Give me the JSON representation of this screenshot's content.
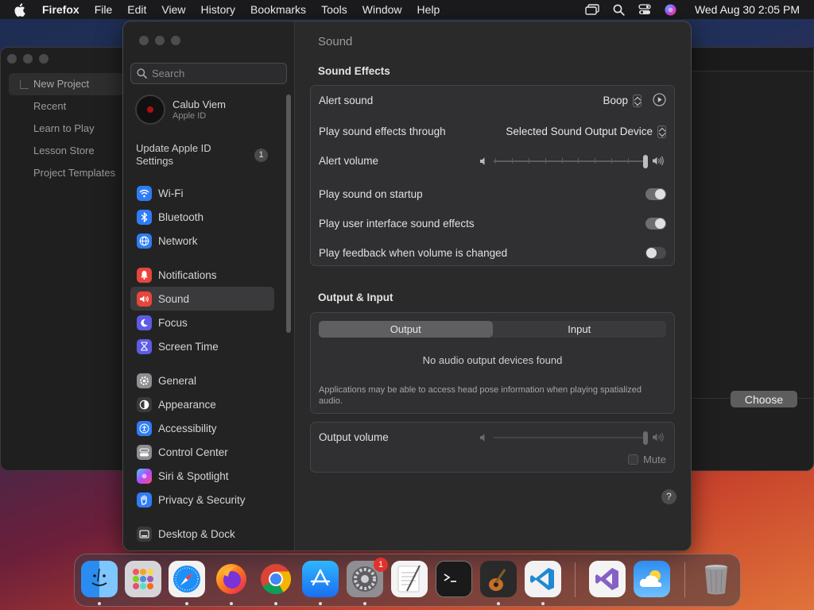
{
  "menubar": {
    "app_name": "Firefox",
    "items": [
      "File",
      "Edit",
      "View",
      "History",
      "Bookmarks",
      "Tools",
      "Window",
      "Help"
    ],
    "clock": "Wed Aug 30  2:05 PM",
    "icons": [
      "apple-icon",
      "screen-mirroring-icon",
      "spotlight-search-icon",
      "control-center-icon",
      "siri-icon"
    ]
  },
  "background_app": {
    "sidebar": [
      "New Project",
      "Recent",
      "Learn to Play",
      "Lesson Store",
      "Project Templates"
    ],
    "choose_label": "Choose"
  },
  "settings": {
    "search_placeholder": "Search",
    "account": {
      "name": "Calub Viem",
      "subtitle": "Apple ID"
    },
    "update": {
      "label": "Update Apple ID Settings",
      "badge": "1"
    },
    "nav_groups": [
      [
        {
          "label": "Wi-Fi",
          "icon": "wifi-icon",
          "color": "#2f7cf6"
        },
        {
          "label": "Bluetooth",
          "icon": "bluetooth-icon",
          "color": "#2f7cf6"
        },
        {
          "label": "Network",
          "icon": "globe-icon",
          "color": "#2f7cf6"
        }
      ],
      [
        {
          "label": "Notifications",
          "icon": "bell-icon",
          "color": "#e8453c"
        },
        {
          "label": "Sound",
          "icon": "speaker-icon",
          "color": "#e8453c",
          "selected": true
        },
        {
          "label": "Focus",
          "icon": "moon-icon",
          "color": "#5e5ce6"
        },
        {
          "label": "Screen Time",
          "icon": "hourglass-icon",
          "color": "#5e5ce6"
        }
      ],
      [
        {
          "label": "General",
          "icon": "gear-icon",
          "color": "#8e8e93"
        },
        {
          "label": "Appearance",
          "icon": "appearance-icon",
          "color": "#3a3a3c"
        },
        {
          "label": "Accessibility",
          "icon": "accessibility-icon",
          "color": "#2f7cf6"
        },
        {
          "label": "Control Center",
          "icon": "control-center-icon",
          "color": "#8e8e93"
        },
        {
          "label": "Siri & Spotlight",
          "icon": "siri-icon",
          "color": "#b04ad0"
        },
        {
          "label": "Privacy & Security",
          "icon": "hand-icon",
          "color": "#2f7cf6"
        }
      ],
      [
        {
          "label": "Desktop & Dock",
          "icon": "dock-icon",
          "color": "#3a3a3c"
        }
      ]
    ],
    "content": {
      "title": "Sound",
      "sound_effects": {
        "heading": "Sound Effects",
        "alert_sound": {
          "label": "Alert sound",
          "value": "Boop"
        },
        "output_through": {
          "label": "Play sound effects through",
          "value": "Selected Sound Output Device"
        },
        "alert_volume": {
          "label": "Alert volume",
          "level": 1.0
        },
        "startup": {
          "label": "Play sound on startup",
          "on": true
        },
        "ui_effects": {
          "label": "Play user interface sound effects",
          "on": true
        },
        "feedback": {
          "label": "Play feedback when volume is changed",
          "on": false
        }
      },
      "output_input": {
        "heading": "Output & Input",
        "tabs": [
          "Output",
          "Input"
        ],
        "empty": "No audio output devices found",
        "note": "Applications may be able to access head pose information when playing spatialized audio."
      },
      "output_volume": {
        "label": "Output volume",
        "level": 1.0,
        "mute_label": "Mute"
      },
      "help": "?"
    }
  },
  "dock": {
    "apps": [
      {
        "name": "finder-icon",
        "running": true
      },
      {
        "name": "launchpad-icon",
        "running": false
      },
      {
        "name": "safari-icon",
        "running": true
      },
      {
        "name": "firefox-icon",
        "running": true
      },
      {
        "name": "chrome-icon",
        "running": true
      },
      {
        "name": "app-store-icon",
        "running": true
      },
      {
        "name": "system-settings-icon",
        "running": true,
        "badge": "1"
      },
      {
        "name": "textedit-icon",
        "running": false
      },
      {
        "name": "terminal-icon",
        "running": false
      },
      {
        "name": "garageband-icon",
        "running": true
      },
      {
        "name": "vscode-icon",
        "running": true
      },
      {
        "name": "visual-studio-icon",
        "running": false
      },
      {
        "name": "weather-icon",
        "running": false
      },
      {
        "name": "trash-icon",
        "running": false
      }
    ]
  }
}
